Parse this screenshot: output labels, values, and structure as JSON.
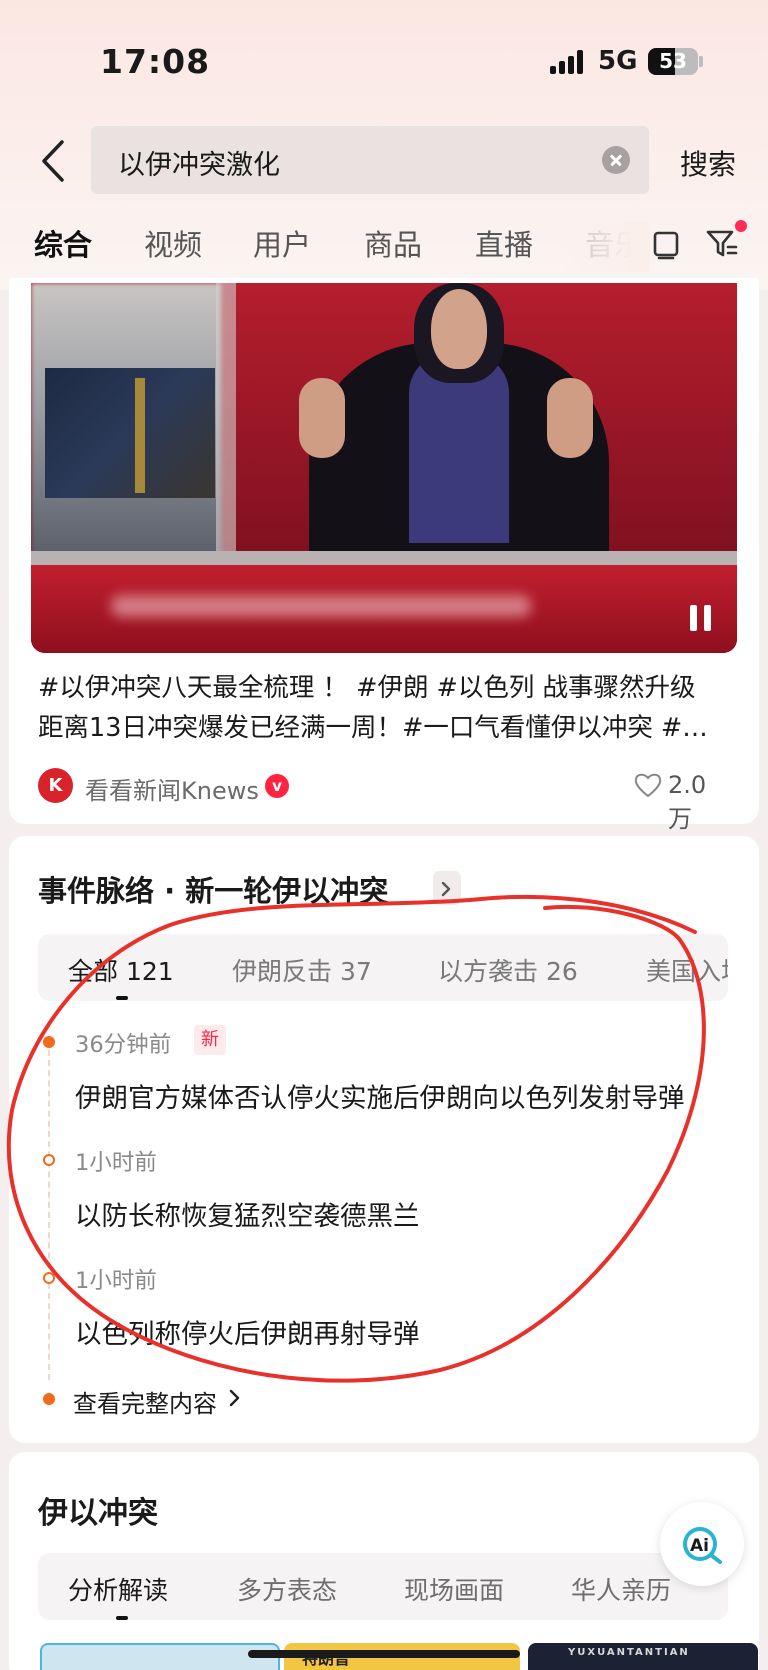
{
  "status": {
    "time": "17:08",
    "network": "5G",
    "battery": "53",
    "battery_level_pct": 53
  },
  "search": {
    "query": "以伊冲突激化",
    "button": "搜索"
  },
  "tabs": [
    "综合",
    "视频",
    "用户",
    "商品",
    "直播",
    "音乐"
  ],
  "video_card": {
    "caption_line1": "#以伊冲突八天最全梳理 ！ #伊朗 #以色列 战事骤然升级",
    "caption_line2": "距离13日冲突爆发已经满一周！#一口气看懂伊以冲突 #…",
    "author": "看看新闻Knews",
    "avatar_text": "K",
    "verified_badge": "v",
    "likes": "2.0万"
  },
  "timeline": {
    "title": "事件脉络 · 新一轮伊以冲突",
    "tabs": [
      {
        "label": "全部 121"
      },
      {
        "label": "伊朗反击 37"
      },
      {
        "label": "以方袭击 26"
      },
      {
        "label": "美国入场"
      }
    ],
    "items": [
      {
        "time": "36分钟前",
        "badge": "新",
        "text": "伊朗官方媒体否认停火实施后伊朗向以色列发射导弹"
      },
      {
        "time": "1小时前",
        "text": "以防长称恢复猛烈空袭德黑兰"
      },
      {
        "time": "1小时前",
        "text": "以色列称停火后伊朗再射导弹"
      }
    ],
    "view_all": "查看完整内容"
  },
  "topic": {
    "title": "伊以冲突",
    "tabs": [
      "分析解读",
      "多方表态",
      "现场画面",
      "华人亲历"
    ],
    "thumb2_text": "特朗普",
    "thumb3_text": "YUXUANTANTIAN"
  },
  "ai_button": "Ai",
  "colors": {
    "accent": "#ff2442",
    "timeline_dot": "#f36a1a",
    "annotation": "#e8312a"
  }
}
